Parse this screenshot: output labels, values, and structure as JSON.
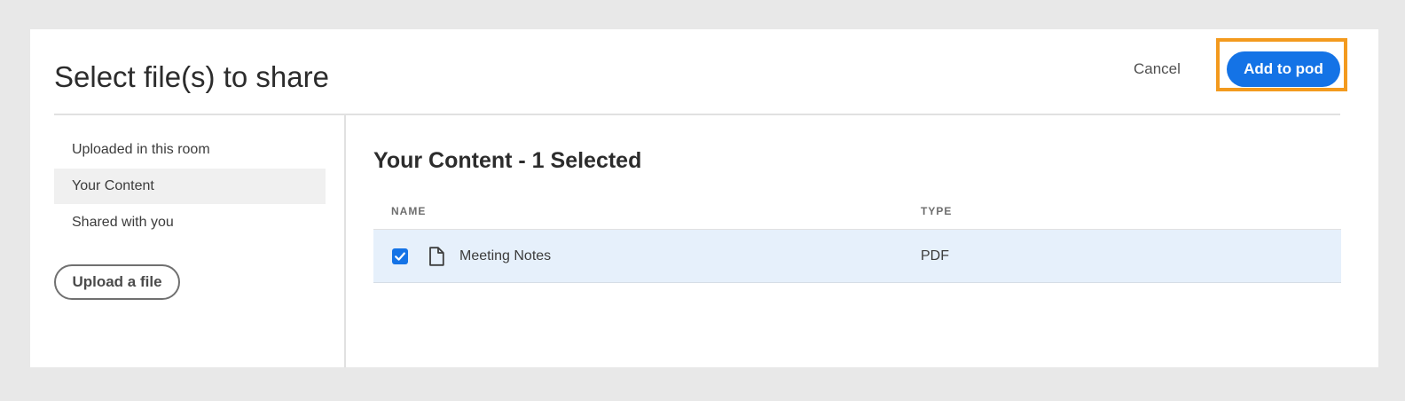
{
  "dialog": {
    "title": "Select file(s) to share",
    "cancel_label": "Cancel",
    "primary_label": "Add to pod"
  },
  "sidebar": {
    "items": [
      {
        "label": "Uploaded in this room",
        "active": false
      },
      {
        "label": "Your Content",
        "active": true
      },
      {
        "label": "Shared with you",
        "active": false
      }
    ],
    "upload_label": "Upload a file"
  },
  "content": {
    "title": "Your Content - 1 Selected",
    "columns": {
      "name": "NAME",
      "type": "TYPE"
    },
    "rows": [
      {
        "name": "Meeting Notes",
        "type": "PDF",
        "checked": true,
        "icon": "document-icon"
      }
    ]
  },
  "colors": {
    "primary": "#1473e6",
    "highlight": "#f39a1e",
    "selected_row": "#e6f0fb",
    "sidebar_active": "#f0f0f0"
  }
}
